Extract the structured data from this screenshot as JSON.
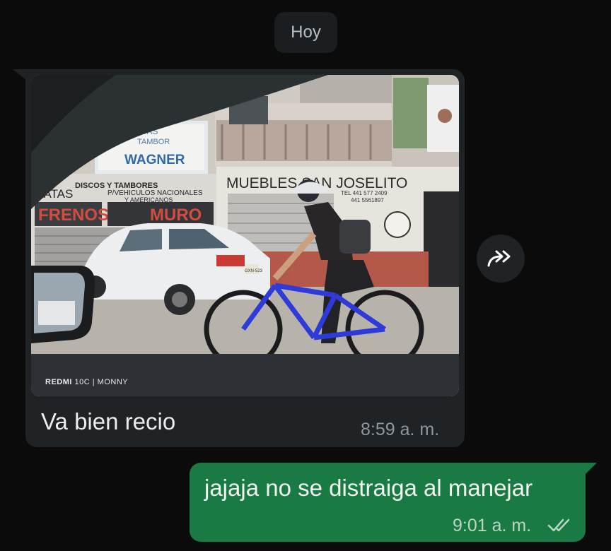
{
  "date_separator": "Hoy",
  "incoming": {
    "photo_watermark_brand": "REDMI",
    "photo_watermark_rest": " 10C | MONNY",
    "photo_signs": {
      "wagner": "WAGNER",
      "tambor": "TAMBOR",
      "atas": "ATAS",
      "discos": "DISCOS Y TAMBORES",
      "vehiculos": "P/VEHICULOS NACIONALES",
      "americanos": "Y AMERICANOS",
      "latas": "LATAS",
      "frenos": "FRENOS",
      "muro": "MURO",
      "muebles": "MUEBLES SAN JOSELITO",
      "tel1": "TEL 441 577 2409",
      "tel2": "441 5561897",
      "plate": "GXN-523"
    },
    "text": "Va bien recio",
    "time": "8:59 a. m."
  },
  "outgoing": {
    "text": "jajaja no se distraiga al manejar",
    "time": "9:01 a. m.",
    "status": "read"
  },
  "icons": {
    "forward": "forward-icon",
    "read_receipt": "double-check-icon"
  },
  "colors": {
    "background": "#0b0b0b",
    "incoming_bubble": "#202325",
    "outgoing_bubble": "#1a7a43"
  }
}
